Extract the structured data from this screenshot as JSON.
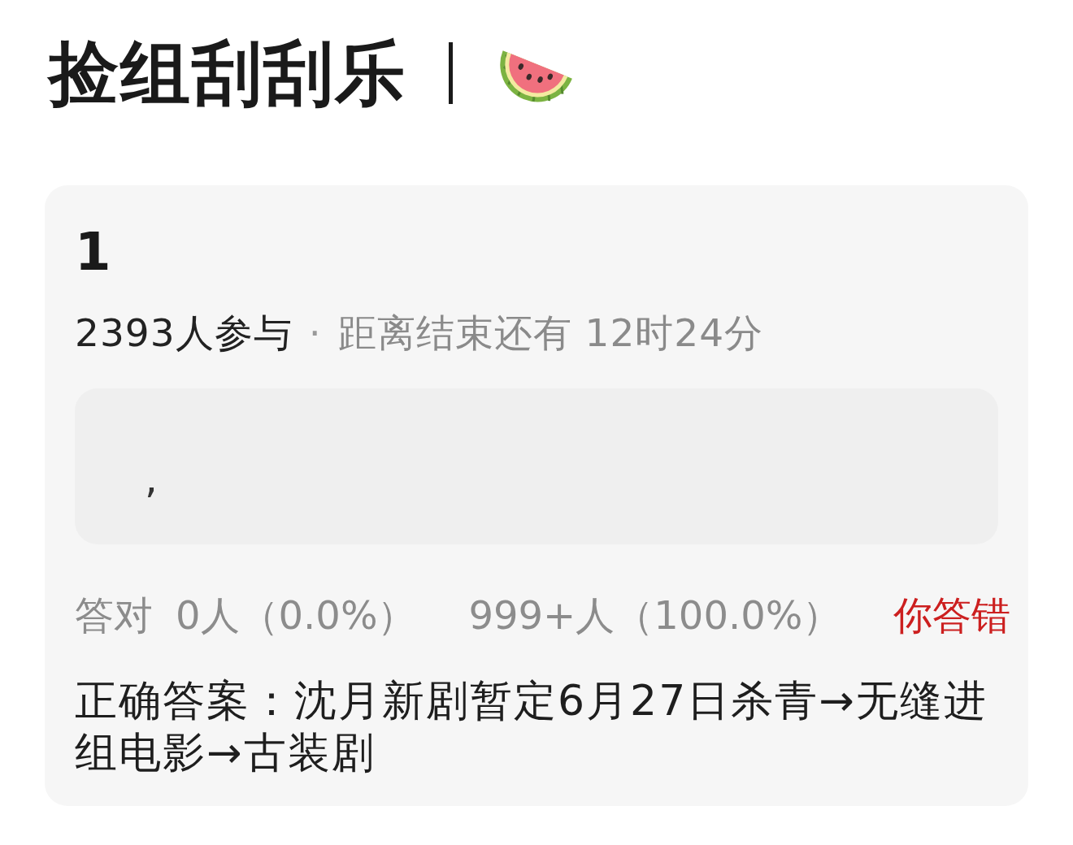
{
  "header": {
    "title": "捡组刮刮乐"
  },
  "card": {
    "number": "1",
    "meta": {
      "participants": "2393人参与",
      "separator": "·",
      "countdown": "距离结束还有 12时24分"
    },
    "content": ",",
    "stats": [
      {
        "label": "答对",
        "value": "0人（0.0%）"
      },
      {
        "value": "999+人（100.0%）"
      }
    ],
    "result": {
      "text": "你答错",
      "correct": false
    },
    "answer": "正确答案：沈月新剧暂定6月27日杀青→无缝进组电影→古装剧"
  }
}
